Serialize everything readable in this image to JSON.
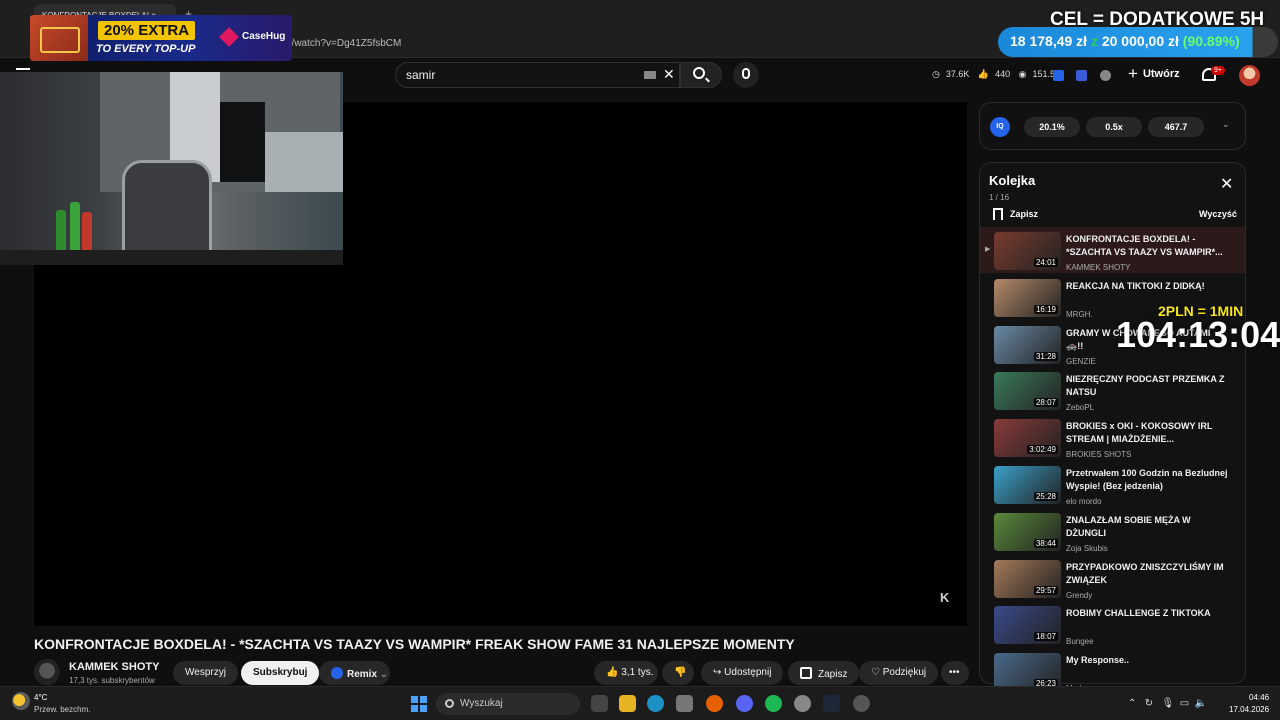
{
  "browser": {
    "tab_title": "KONFRONTACJE BOXDELA!",
    "url": "n/watch?v=Dg41Z5fsbCM"
  },
  "promo": {
    "headline": "20% EXTRA",
    "subline": "TO EVERY TOP-UP",
    "brand": "CaseHug"
  },
  "goal": {
    "title": "CEL = DODATKOWE 5H",
    "current": "18 178,49 zł",
    "z": "z",
    "target": "20 000,00 zł",
    "percent": "(90.89%)",
    "progress": 0.9089
  },
  "header": {
    "search_value": "samir",
    "stats": [
      "37.6K",
      "440",
      "151.5K"
    ],
    "create_label": "Utwórz",
    "notifications_badge": "9+"
  },
  "video": {
    "title": "KONFRONTACJE BOXDELA! - *SZACHTA VS TAAZY VS WAMPIR* FREAK SHOW FAME 31 NAJLEPSZE MOMENTY",
    "channel": "KAMMEK SHOTY",
    "subscribers": "17,3 tys. subskrybentów",
    "support_label": "Wesprzyj",
    "subscribe_label": "Subskrybuj",
    "remix_label": "Remix",
    "likes": "3,1 tys.",
    "share_label": "Udostępnij",
    "save_label": "Zapisz",
    "thanks_label": "Podziękuj",
    "player_logo": "K"
  },
  "extension": {
    "badge": "IQ",
    "values": [
      "20.1%",
      "0.5x",
      "467.7"
    ]
  },
  "queue": {
    "title": "Kolejka",
    "count": "1 / 16",
    "save_label": "Zapisz",
    "clear_label": "Wyczyść",
    "items": [
      {
        "title": "KONFRONTACJE BOXDELA! - *SZACHTA VS TAAZY VS WAMPIR*...",
        "channel": "KAMMEK SHOTY",
        "duration": "24:01",
        "color": "#7a3b2e"
      },
      {
        "title": "REAKCJA NA TIKTOKI Z DIDKĄ!",
        "channel": "MRGH.",
        "duration": "16:19",
        "color": "#b58a6a"
      },
      {
        "title": "GRAMY W CHOWANEGO AUTAMI 🚓!!",
        "channel": "GENZIE",
        "duration": "31:28",
        "color": "#6a8aa5"
      },
      {
        "title": "NIEZRĘCZNY PODCAST PRZEMKA Z NATSU",
        "channel": "ZeboPL",
        "duration": "28:07",
        "color": "#3a7a5a"
      },
      {
        "title": "BROKIES x OKI - KOKOSOWY IRL STREAM | MIAŻDŻENIE...",
        "channel": "BROKIES SHOTS",
        "duration": "3:02:49",
        "color": "#8a3a3a"
      },
      {
        "title": "Przetrwałem 100 Godzin na Bezludnej Wyspie! (Bez jedzenia)",
        "channel": "elo mordo",
        "duration": "25:28",
        "color": "#3aa0c8"
      },
      {
        "title": "ZNALAZŁAM SOBIE MĘŻA W DŻUNGLI",
        "channel": "Zoja Skubis",
        "duration": "38:44",
        "color": "#5a8a3a"
      },
      {
        "title": "PRZYPADKOWO ZNISZCZYLIŚMY IM ZWIĄZEK",
        "channel": "Grendy",
        "duration": "29:57",
        "color": "#a57a5a"
      },
      {
        "title": "ROBIMY CHALLENGE Z TIKTOKA",
        "channel": "Bungee",
        "duration": "18:07",
        "color": "#3a4a8a"
      },
      {
        "title": "My Response..",
        "channel": "Marlon",
        "duration": "26:23",
        "color": "#4a6a8a"
      }
    ]
  },
  "timer": {
    "label": "2PLN = 1MIN",
    "value": "104:13:04"
  },
  "taskbar": {
    "weather_temp": "4°C",
    "weather_desc": "Przew. bezchm.",
    "search_placeholder": "Wyszukaj",
    "time": "04:46",
    "date": "17.04.2026"
  }
}
